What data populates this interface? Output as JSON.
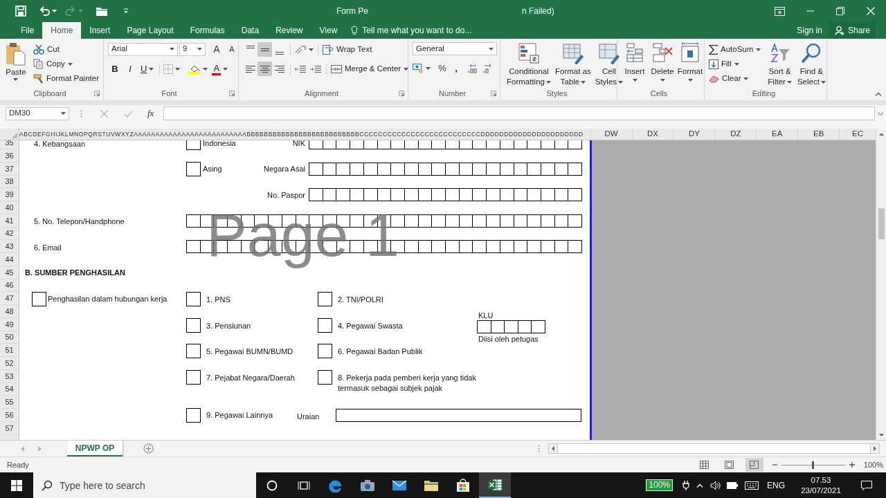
{
  "window": {
    "title_start": "Form Pe",
    "title_end": "n Failed)"
  },
  "tabs": [
    {
      "label": "File",
      "selected": false
    },
    {
      "label": "Home",
      "selected": true
    },
    {
      "label": "Insert",
      "selected": false
    },
    {
      "label": "Page Layout",
      "selected": false
    },
    {
      "label": "Formulas",
      "selected": false
    },
    {
      "label": "Data",
      "selected": false
    },
    {
      "label": "Review",
      "selected": false
    },
    {
      "label": "View",
      "selected": false
    }
  ],
  "tell_me": "Tell me what you want to do...",
  "account": {
    "sign_in": "Sign in",
    "share": "Share"
  },
  "ribbon": {
    "clipboard": {
      "paste": "Paste",
      "cut": "Cut",
      "copy": "Copy",
      "format_painter": "Format Painter",
      "label": "Clipboard"
    },
    "font": {
      "name": "Arial",
      "size": "9",
      "grow": "A",
      "shrink": "A",
      "bold": "B",
      "italic": "I",
      "underline": "U",
      "font_color": "A",
      "label": "Font"
    },
    "alignment": {
      "vertical": [
        {
          "selected": false
        },
        {
          "selected": true
        },
        {
          "selected": false
        }
      ],
      "horizontal": [
        {
          "selected": false
        },
        {
          "selected": true
        },
        {
          "selected": false
        }
      ],
      "wrap_text": "Wrap Text",
      "merge": "Merge & Center",
      "label": "Alignment"
    },
    "number": {
      "format": "General",
      "percent": "%",
      "comma": ",",
      "label": "Number"
    },
    "styles": {
      "buttons": [
        {
          "line1": "Conditional",
          "line2": "Formatting"
        },
        {
          "line1": "Format as",
          "line2": "Table"
        },
        {
          "line1": "Cell",
          "line2": "Styles"
        }
      ],
      "label": "Styles"
    },
    "cells": {
      "buttons": [
        "Insert",
        "Delete",
        "Format"
      ],
      "label": "Cells"
    },
    "editing": {
      "autosum": "AutoSum",
      "fill": "Fill",
      "clear": "Clear",
      "sort": {
        "line1": "Sort &",
        "line2": "Filter"
      },
      "find": {
        "line1": "Find &",
        "line2": "Select"
      },
      "label": "Editing"
    }
  },
  "formula_bar": {
    "name_box": "DM30",
    "fx": "fx"
  },
  "columns": {
    "compressed": "ABCDEFGHIJKLMNOPQRSTUVWXYZAAAAAAAAAAAAAAAAAAAAAAAAAABBBBBBBBBBBBBBBBBBBBBBBBBBCCCCCCCCCCCCCCCCCCCCCCCCCCDDDDDDDDDDDDDDDDDDDDDD",
    "headers": [
      "DW",
      "DX",
      "DY",
      "DZ",
      "EA",
      "EB",
      "EC"
    ]
  },
  "row_numbers": [
    "35",
    "36",
    "37",
    "38",
    "39",
    "40",
    "41",
    "42",
    "43",
    "44",
    "45",
    "46",
    "47",
    "48",
    "49",
    "50",
    "51",
    "52",
    "53",
    "54",
    "55",
    "56",
    "57"
  ],
  "form": {
    "page_label": "Page 1",
    "lines": [
      {
        "kind": "option-field",
        "label": "4. Kebangsaan",
        "option": {
          "label": "Indonesia",
          "checked": false
        },
        "field_label": "NIK"
      },
      {
        "kind": "option-field",
        "option": {
          "label": "Asing",
          "checked": false
        },
        "field_label": "Negara Asal"
      },
      {
        "kind": "field",
        "field_label": "No. Paspor"
      },
      {
        "kind": "long-field",
        "label": "5. No. Telepon/Handphone"
      },
      {
        "kind": "long-field",
        "label": "6. Email"
      },
      {
        "kind": "heading",
        "text": "B. SUMBER PENGHASILAN"
      },
      {
        "kind": "choices",
        "main": {
          "label": "Penghasilan dalam hubungan kerja",
          "checked": false
        },
        "choices": [
          {
            "label": "1. PNS",
            "checked": false
          },
          {
            "label": "2. TNI/POLRI",
            "checked": false
          }
        ]
      },
      {
        "kind": "choices",
        "choices": [
          {
            "label": "3. Pensiunan",
            "checked": false
          },
          {
            "label": "4. Pegawai Swasta",
            "checked": false
          }
        ],
        "klu": {
          "label": "KLU",
          "note": "Diisi oleh petugas"
        }
      },
      {
        "kind": "choices",
        "choices": [
          {
            "label": "5. Pegawai BUMN/BUMD",
            "checked": false
          },
          {
            "label": "6. Pegawai Badan Publik",
            "checked": false
          }
        ]
      },
      {
        "kind": "choices",
        "choices": [
          {
            "label": "7. Pejabat Negara/Daerah",
            "checked": false
          },
          {
            "label": "8. Pekerja pada pemberi kerja yang tidak termasuk sebagai subjek pajak",
            "checked": false
          }
        ]
      },
      {
        "kind": "other",
        "choice": {
          "label": "9. Pegawai Lainnya",
          "checked": false
        },
        "field_label": "Uraian"
      }
    ]
  },
  "sheet_tabs": [
    {
      "label": "NPWP OP",
      "selected": true
    }
  ],
  "status_bar": {
    "text": "Ready",
    "views": [
      {
        "selected": false
      },
      {
        "selected": false
      },
      {
        "selected": true
      }
    ],
    "zoom_slider": {
      "level": 0.5
    },
    "zoom": "100%"
  },
  "taskbar": {
    "search": {
      "placeholder": "Type here to search"
    },
    "apps": [
      {
        "kind": "cortana",
        "active": false
      },
      {
        "kind": "task-view",
        "active": false
      },
      {
        "kind": "edge",
        "active": false
      },
      {
        "kind": "camera",
        "active": false
      },
      {
        "kind": "mail",
        "active": false
      },
      {
        "kind": "explorer",
        "active": false
      },
      {
        "kind": "store",
        "active": false
      },
      {
        "kind": "excel",
        "active": true
      }
    ],
    "battery": "100%",
    "language": "ENG",
    "time": "07.53",
    "date": "23/07/2021"
  }
}
